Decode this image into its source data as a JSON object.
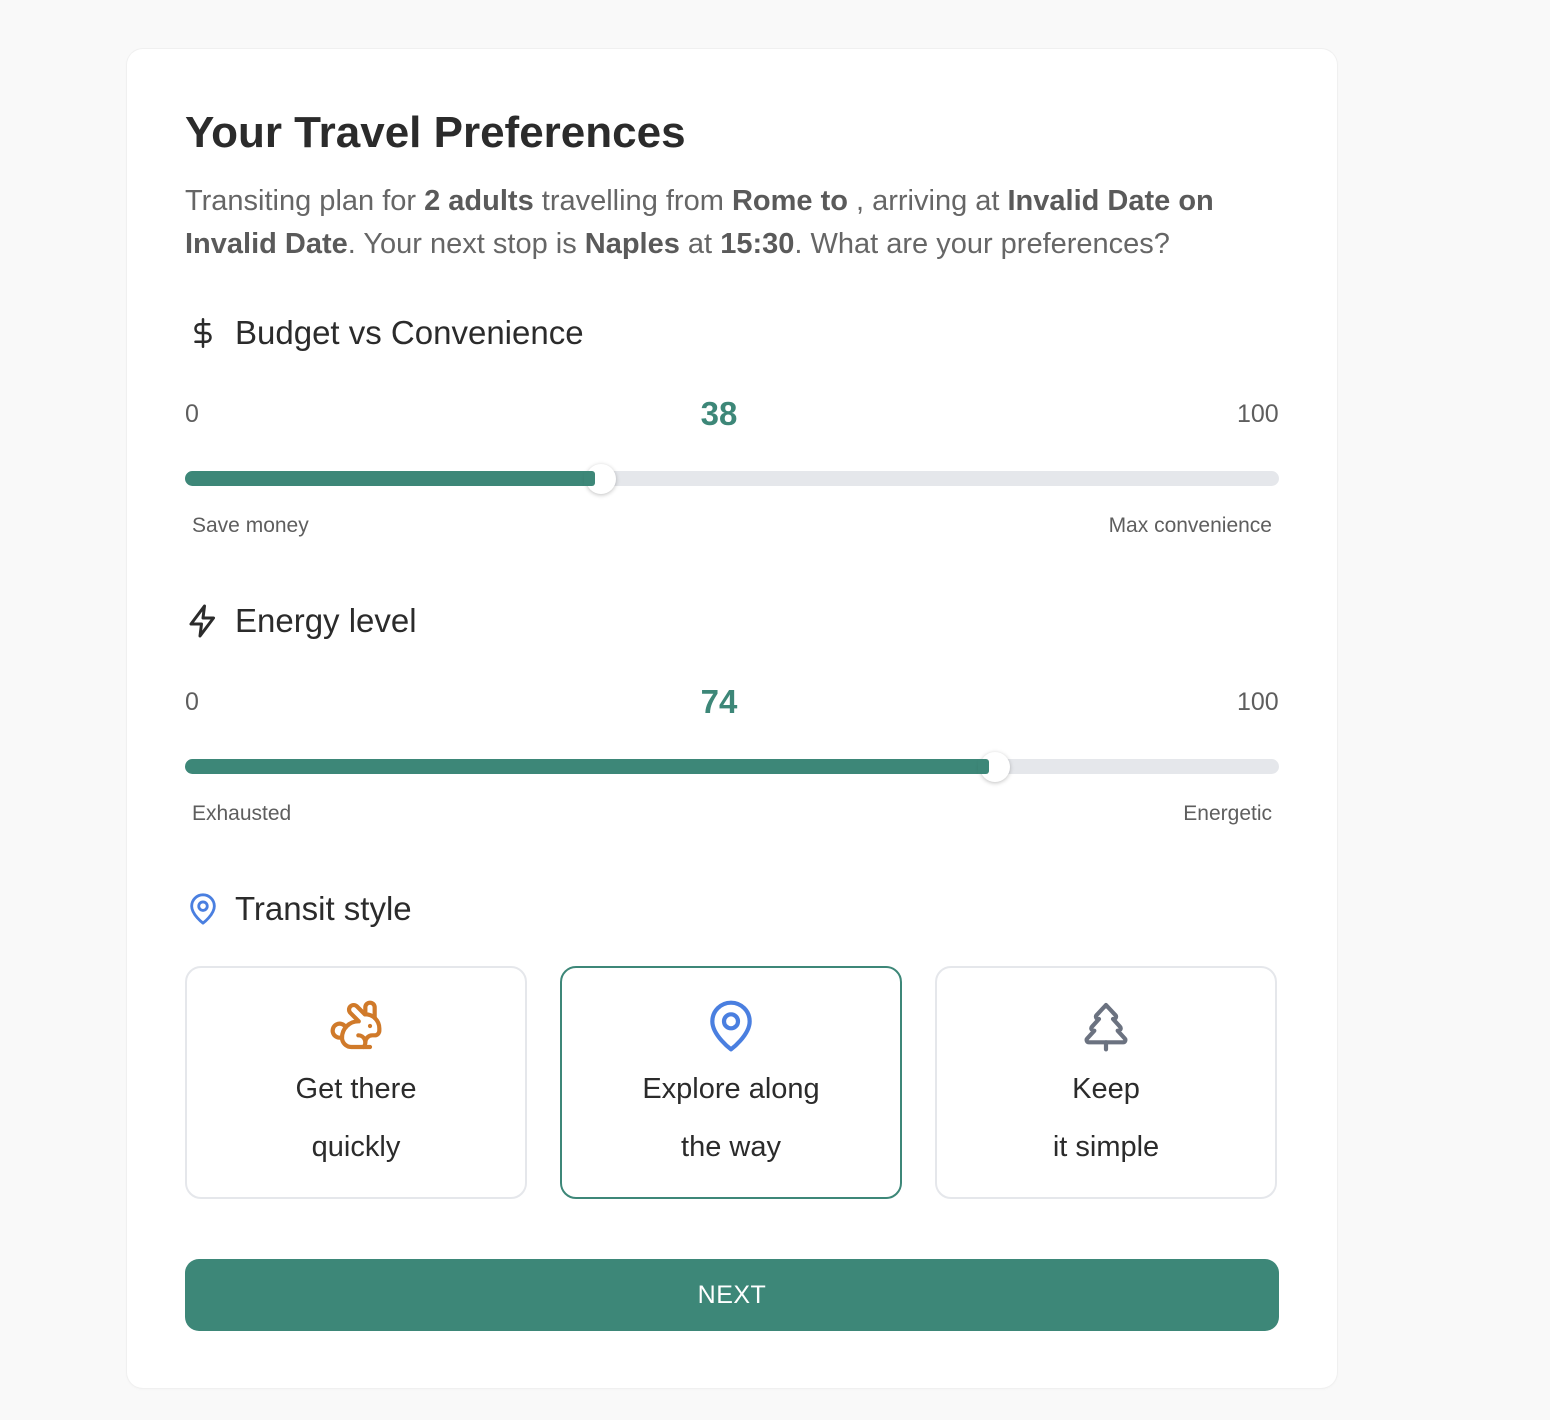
{
  "header": {
    "title": "Your Travel Preferences"
  },
  "intro": {
    "p1": "Transiting plan for ",
    "b1": "2 adults",
    "p2": " travelling from ",
    "b2": "Rome to",
    "p3": " , arriving at ",
    "b3": "Invalid Date on Invalid Date",
    "p4": ". Your next stop is ",
    "b4": "Naples",
    "p5": " at ",
    "b5": "15:30",
    "p6": ". What are your preferences?"
  },
  "budget": {
    "icon": "dollar-icon",
    "label": "Budget vs Convenience",
    "min": "0",
    "max": "100",
    "value": 38,
    "left_label": "Save money",
    "right_label": "Max convenience"
  },
  "energy": {
    "icon": "lightning-icon",
    "label": "Energy level",
    "min": "0",
    "max": "100",
    "value": 74,
    "left_label": "Exhausted",
    "right_label": "Energetic"
  },
  "transit": {
    "icon": "map-pin-icon",
    "label": "Transit style",
    "options": [
      {
        "icon": "rabbit-icon",
        "line1": "Get there",
        "line2": "quickly",
        "selected": false
      },
      {
        "icon": "map-pin-icon",
        "line1": "Explore along",
        "line2": "the way",
        "selected": true
      },
      {
        "icon": "tree-icon",
        "line1": "Keep",
        "line2": "it simple",
        "selected": false
      }
    ]
  },
  "actions": {
    "next_label": "NEXT"
  },
  "colors": {
    "accent": "#3d8778",
    "pin_blue": "#4a7fe0",
    "rabbit_orange": "#d07a2a",
    "tree_gray": "#6b7280"
  }
}
